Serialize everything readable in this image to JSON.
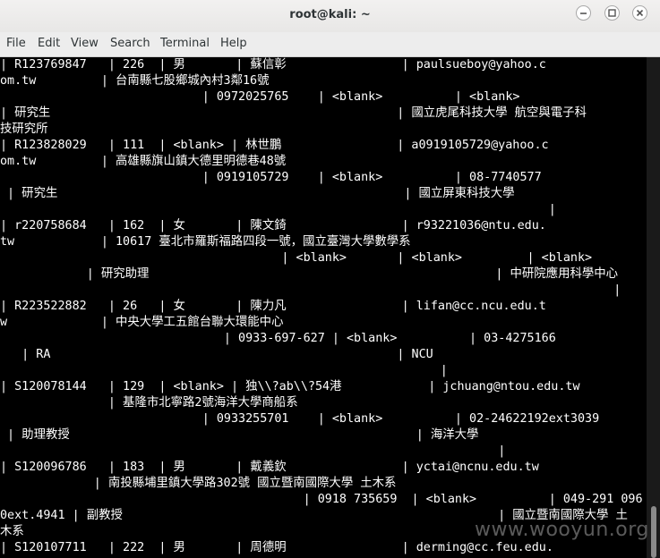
{
  "window": {
    "title": "root@kali: ~"
  },
  "menu": [
    "File",
    "Edit",
    "View",
    "Search",
    "Terminal",
    "Help"
  ],
  "terminal_lines": [
    "| R123769847   | 226  | 男       | 蘇信彰                | paulsueboy@yahoo.c",
    "om.tw         | 台南縣七股鄉城內村3鄰16號",
    "                            | 0972025765    | <blank>          | <blank>",
    "| 研究生                                                | 國立虎尾科技大學 航空與電子科",
    "技研究所",
    "| R123828029   | 111  | <blank> | 林世鵬                | a0919105729@yahoo.c",
    "om.tw         | 高雄縣旗山鎮大德里明德巷48號",
    "                            | 0919105729    | <blank>          | 08-7740577",
    " | 研究生                                                | 國立屏東科技大學",
    "                                                                            |",
    "| r220758684   | 162  | 女       | 陳文錡                | r93221036@ntu.edu.",
    "tw            | 10617 臺北市羅斯福路四段一號，國立臺灣大學數學系",
    "                                       | <blank>       | <blank>         | <blank>",
    "            | 研究助理                                                | 中研院應用科學中心",
    "                                                                                     |",
    "| R223522882   | 26   | 女       | 陳力凡                | lifan@cc.ncu.edu.t",
    "w             | 中央大學工五館台聯大環能中心",
    "                               | 0933-697-627 | <blank>          | 03-4275166",
    "   | RA                                                | NCU",
    "                                                             |",
    "| S120078144   | 129  | <blank> | 独\\\\?ab\\\\?54港            | jchuang@ntou.edu.tw",
    "               | 基隆市北寧路2號海洋大學商船系",
    "                            | 0933255701    | <blank>          | 02-24622192ext3039",
    " | 助理教授                                                | 海洋大學",
    "                                                                     |",
    "| S120096786   | 183  | 男       | 戴義欽                | yctai@ncnu.edu.tw",
    "             | 南投縣埔里鎮大學路302號 國立暨南國際大學 土木系",
    "                                          | 0918 735659  | <blank>          | 049-291 096",
    "0ext.4941 | 副教授                                                    | 國立暨南國際大學 土",
    "木系",
    "| S120107711   | 222  | 男       | 周德明                | derming@cc.feu.edu."
  ],
  "watermark": "www.wooyun.org"
}
